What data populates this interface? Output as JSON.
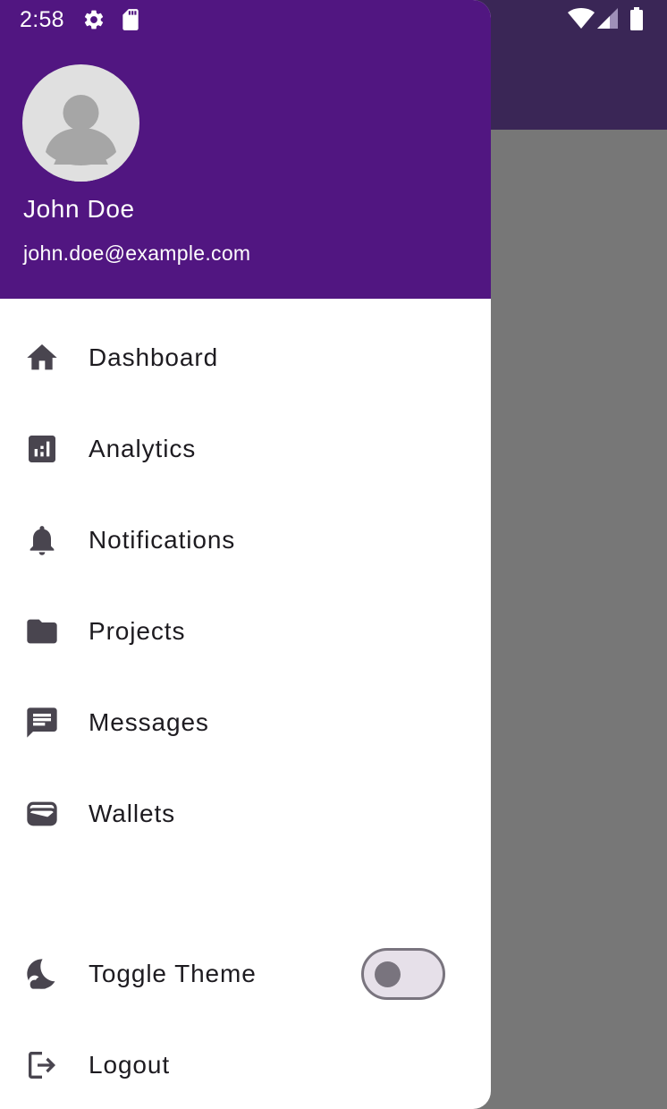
{
  "status_bar": {
    "time": "2:58",
    "left_icons": [
      "gear-icon",
      "sd-card-icon"
    ],
    "right_icons": [
      "wifi-icon",
      "signal-icon",
      "battery-icon"
    ]
  },
  "colors": {
    "header_bg": "#511681",
    "app_bar_bg": "#3a2656",
    "scrim": "#777777",
    "icon": "#49454f",
    "text": "#1d1b20"
  },
  "drawer": {
    "header": {
      "avatar_icon": "person-icon",
      "name": "John Doe",
      "email": "john.doe@example.com"
    },
    "items": [
      {
        "label": "Dashboard",
        "icon": "home-icon"
      },
      {
        "label": "Analytics",
        "icon": "analytics-icon"
      },
      {
        "label": "Notifications",
        "icon": "bell-icon"
      },
      {
        "label": "Projects",
        "icon": "folder-icon"
      },
      {
        "label": "Messages",
        "icon": "message-icon"
      },
      {
        "label": "Wallets",
        "icon": "wallet-icon"
      }
    ],
    "footer": {
      "theme_label": "Toggle Theme",
      "theme_icon": "moon-icon",
      "theme_toggle_on": false,
      "logout_label": "Logout",
      "logout_icon": "logout-icon"
    }
  }
}
